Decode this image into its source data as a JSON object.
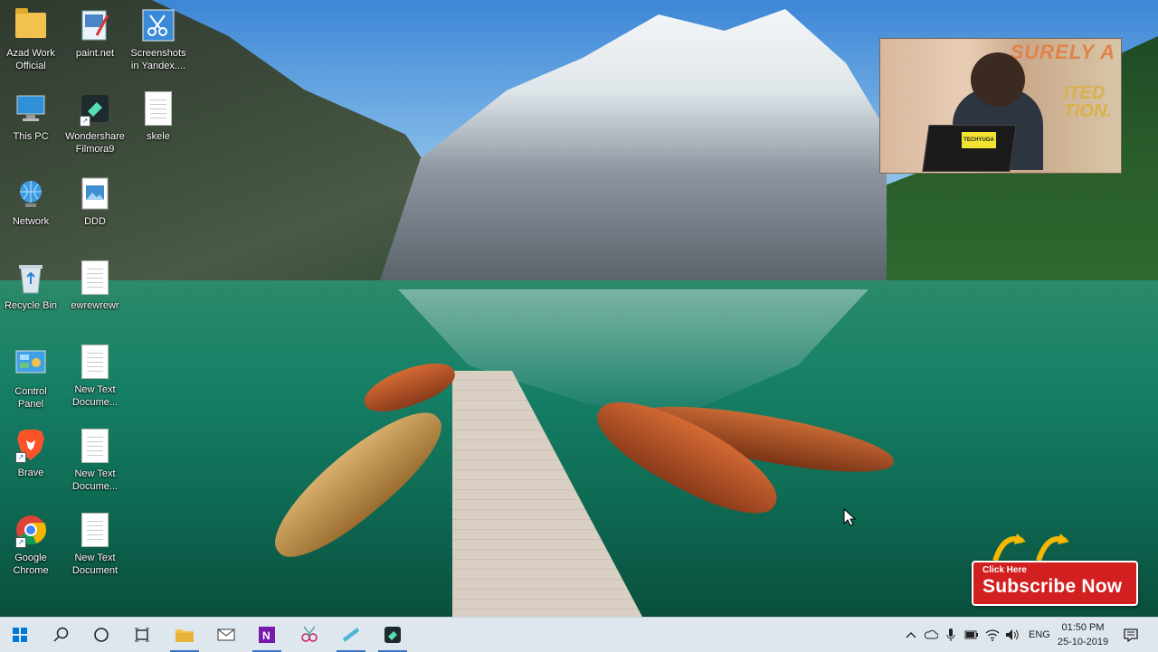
{
  "desktop": {
    "icons": [
      {
        "label": "Azad Work\nOfficial",
        "icon": "folder-icon"
      },
      {
        "label": "paint.net",
        "icon": "paint-net-icon"
      },
      {
        "label": "Screenshots\nin Yandex....",
        "icon": "screenshots-yandex-icon"
      },
      {
        "label": "This PC",
        "icon": "computer-icon"
      },
      {
        "label": "Wondershare\nFilmora9",
        "icon": "filmora-icon"
      },
      {
        "label": "skele",
        "icon": "document-icon"
      },
      {
        "label": "Network",
        "icon": "network-icon"
      },
      {
        "label": "DDD",
        "icon": "image-file-icon"
      },
      {
        "label": "Recycle Bin",
        "icon": "recycle-bin-icon"
      },
      {
        "label": "ewrewrewr",
        "icon": "document-icon"
      },
      {
        "label": "Control\nPanel",
        "icon": "control-panel-icon"
      },
      {
        "label": "New Text\nDocume...",
        "icon": "text-document-icon"
      },
      {
        "label": "Brave",
        "icon": "brave-icon"
      },
      {
        "label": "New Text\nDocume...",
        "icon": "text-document-icon"
      },
      {
        "label": "Google\nChrome",
        "icon": "chrome-icon"
      },
      {
        "label": "New Text\nDocument",
        "icon": "text-document-icon"
      }
    ]
  },
  "overlay": {
    "webcam_banner_line1": "SURELY A",
    "webcam_banner_line2": "ITED\nTION.",
    "webcam_sticker": "TECHYUGA",
    "subscribe_small": "Click Here",
    "subscribe_big": "Subscribe Now"
  },
  "taskbar": {
    "buttons": [
      {
        "name": "start-button",
        "icon": "windows-logo-icon"
      },
      {
        "name": "search-button",
        "icon": "search-icon"
      },
      {
        "name": "cortana-button",
        "icon": "cortana-circle-icon"
      },
      {
        "name": "task-view-button",
        "icon": "task-view-icon"
      },
      {
        "name": "file-explorer-button",
        "icon": "folder-icon"
      },
      {
        "name": "mail-button",
        "icon": "mail-icon"
      },
      {
        "name": "onenote-button",
        "icon": "onenote-icon"
      },
      {
        "name": "snipping-app-button",
        "icon": "snipping-icon"
      },
      {
        "name": "app-button",
        "icon": "app-icon"
      },
      {
        "name": "filmora-taskbar-button",
        "icon": "filmora-icon"
      }
    ],
    "tray": {
      "language": "ENG",
      "time": "01:50 PM",
      "date": "25-10-2019"
    }
  },
  "colors": {
    "taskbar_bg": "#dfe7ee",
    "subscribe_red": "#d21f1f",
    "accent_blue": "#3b78c5"
  }
}
